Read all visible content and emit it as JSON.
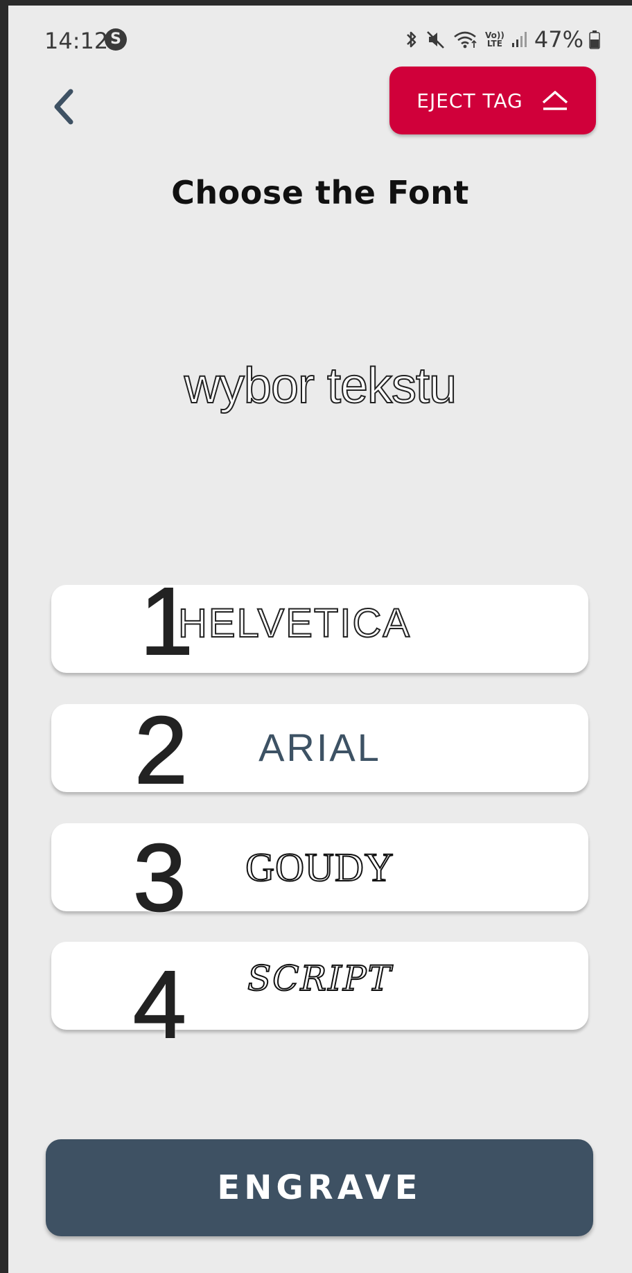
{
  "status_bar": {
    "time": "14:12",
    "notification_icon": "s-badge-icon",
    "lte_label": "Vo)) LTE",
    "battery_percent": "47%"
  },
  "header": {
    "back_icon": "chevron-left-icon",
    "eject_label": "EJECT TAG",
    "eject_icon": "eject-icon",
    "eject_color": "#d0003a"
  },
  "title": "Choose the Font",
  "preview_text": "wybor tekstu",
  "font_options": [
    {
      "number": "1",
      "name": "HELVETICA"
    },
    {
      "number": "2",
      "name": "ARIAL"
    },
    {
      "number": "3",
      "name": "GOUDY"
    },
    {
      "number": "4",
      "name": "SCRIPT"
    }
  ],
  "engrave_label": "ENGRAVE",
  "colors": {
    "background": "#ebebeb",
    "engrave_button": "#3e5163",
    "arial_text": "#3d5264"
  }
}
